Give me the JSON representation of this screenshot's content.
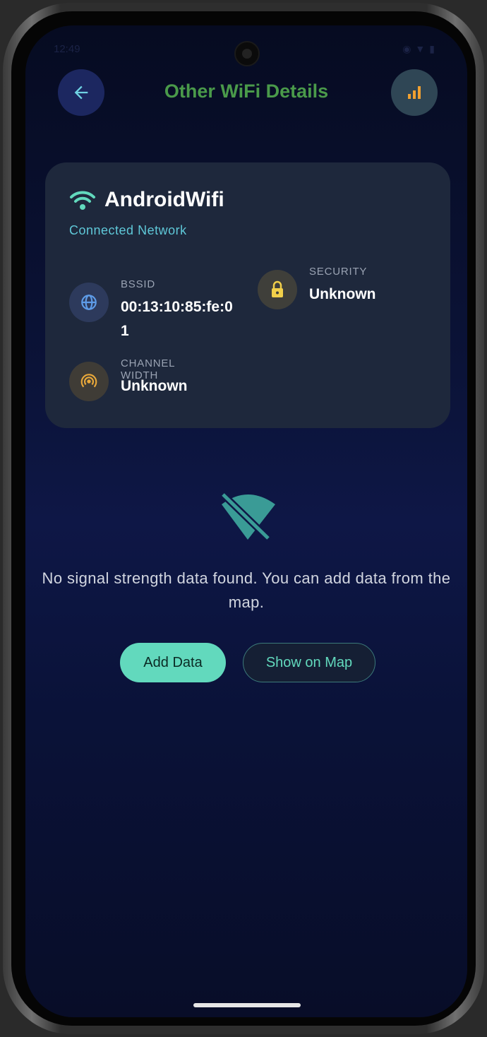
{
  "status_bar": {
    "time": "12:49",
    "icons": [
      "shield-icon",
      "location-icon",
      "wifi-icon",
      "cellular-icon",
      "battery-icon"
    ]
  },
  "header": {
    "title": "Other WiFi Details",
    "back_icon": "arrow-left-icon",
    "action_icon": "bar-chart-icon"
  },
  "network": {
    "name": "AndroidWifi",
    "status": "Connected Network",
    "fields": {
      "bssid": {
        "label": "BSSID",
        "value": "00:13:10:85:fe:01",
        "icon": "globe-icon"
      },
      "security": {
        "label": "SECURITY",
        "value": "Unknown",
        "icon": "lock-icon"
      },
      "channel_width": {
        "label": "CHANNEL WIDTH",
        "value": "Unknown",
        "icon": "broadcast-icon"
      }
    }
  },
  "empty_state": {
    "icon": "wifi-off-icon",
    "message": "No signal strength data found. You can add data from the map."
  },
  "actions": {
    "add_data": "Add Data",
    "show_on_map": "Show on Map"
  },
  "colors": {
    "accent": "#62d9bd",
    "title": "#4a9a4a",
    "card": "#1e283c",
    "link": "#5fc8d8",
    "chart_icon": "#f0a030"
  }
}
